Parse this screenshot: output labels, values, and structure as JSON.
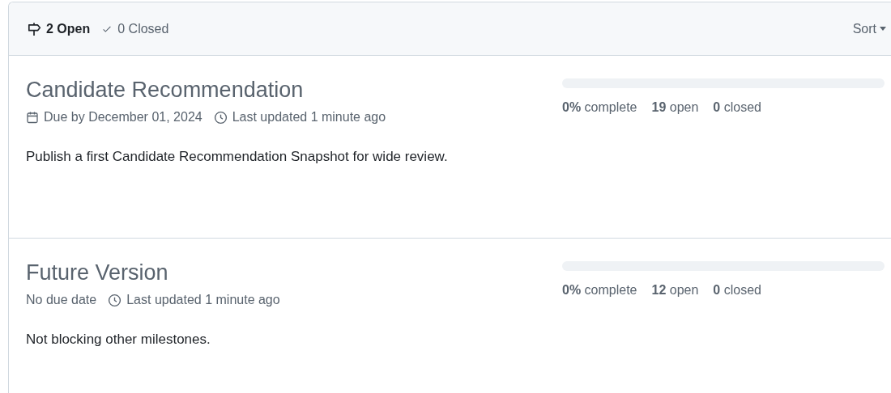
{
  "header": {
    "tabs": [
      {
        "label": "2 Open",
        "selected": true
      },
      {
        "label": "0 Closed",
        "selected": false
      }
    ],
    "sort": "Sort"
  },
  "milestones": [
    {
      "title": "Candidate Recommendation",
      "due": {
        "kind": "date",
        "text": "Due by December 01, 2024"
      },
      "updated": "Last updated 1 minute ago",
      "description": "Publish a first Candidate Recommendation Snapshot for wide review.",
      "level": 0,
      "stats": [
        "**0%** complete",
        "**19** open",
        "**0** closed"
      ]
    },
    {
      "title": "Future Version",
      "due": {
        "kind": "none",
        "text": "No due date"
      },
      "updated": "Last updated 1 minute ago",
      "description": "Not blocking other milestones.",
      "level": 0,
      "stats": [
        "**0%** complete",
        "**12** open",
        "**0** closed"
      ]
    }
  ]
}
